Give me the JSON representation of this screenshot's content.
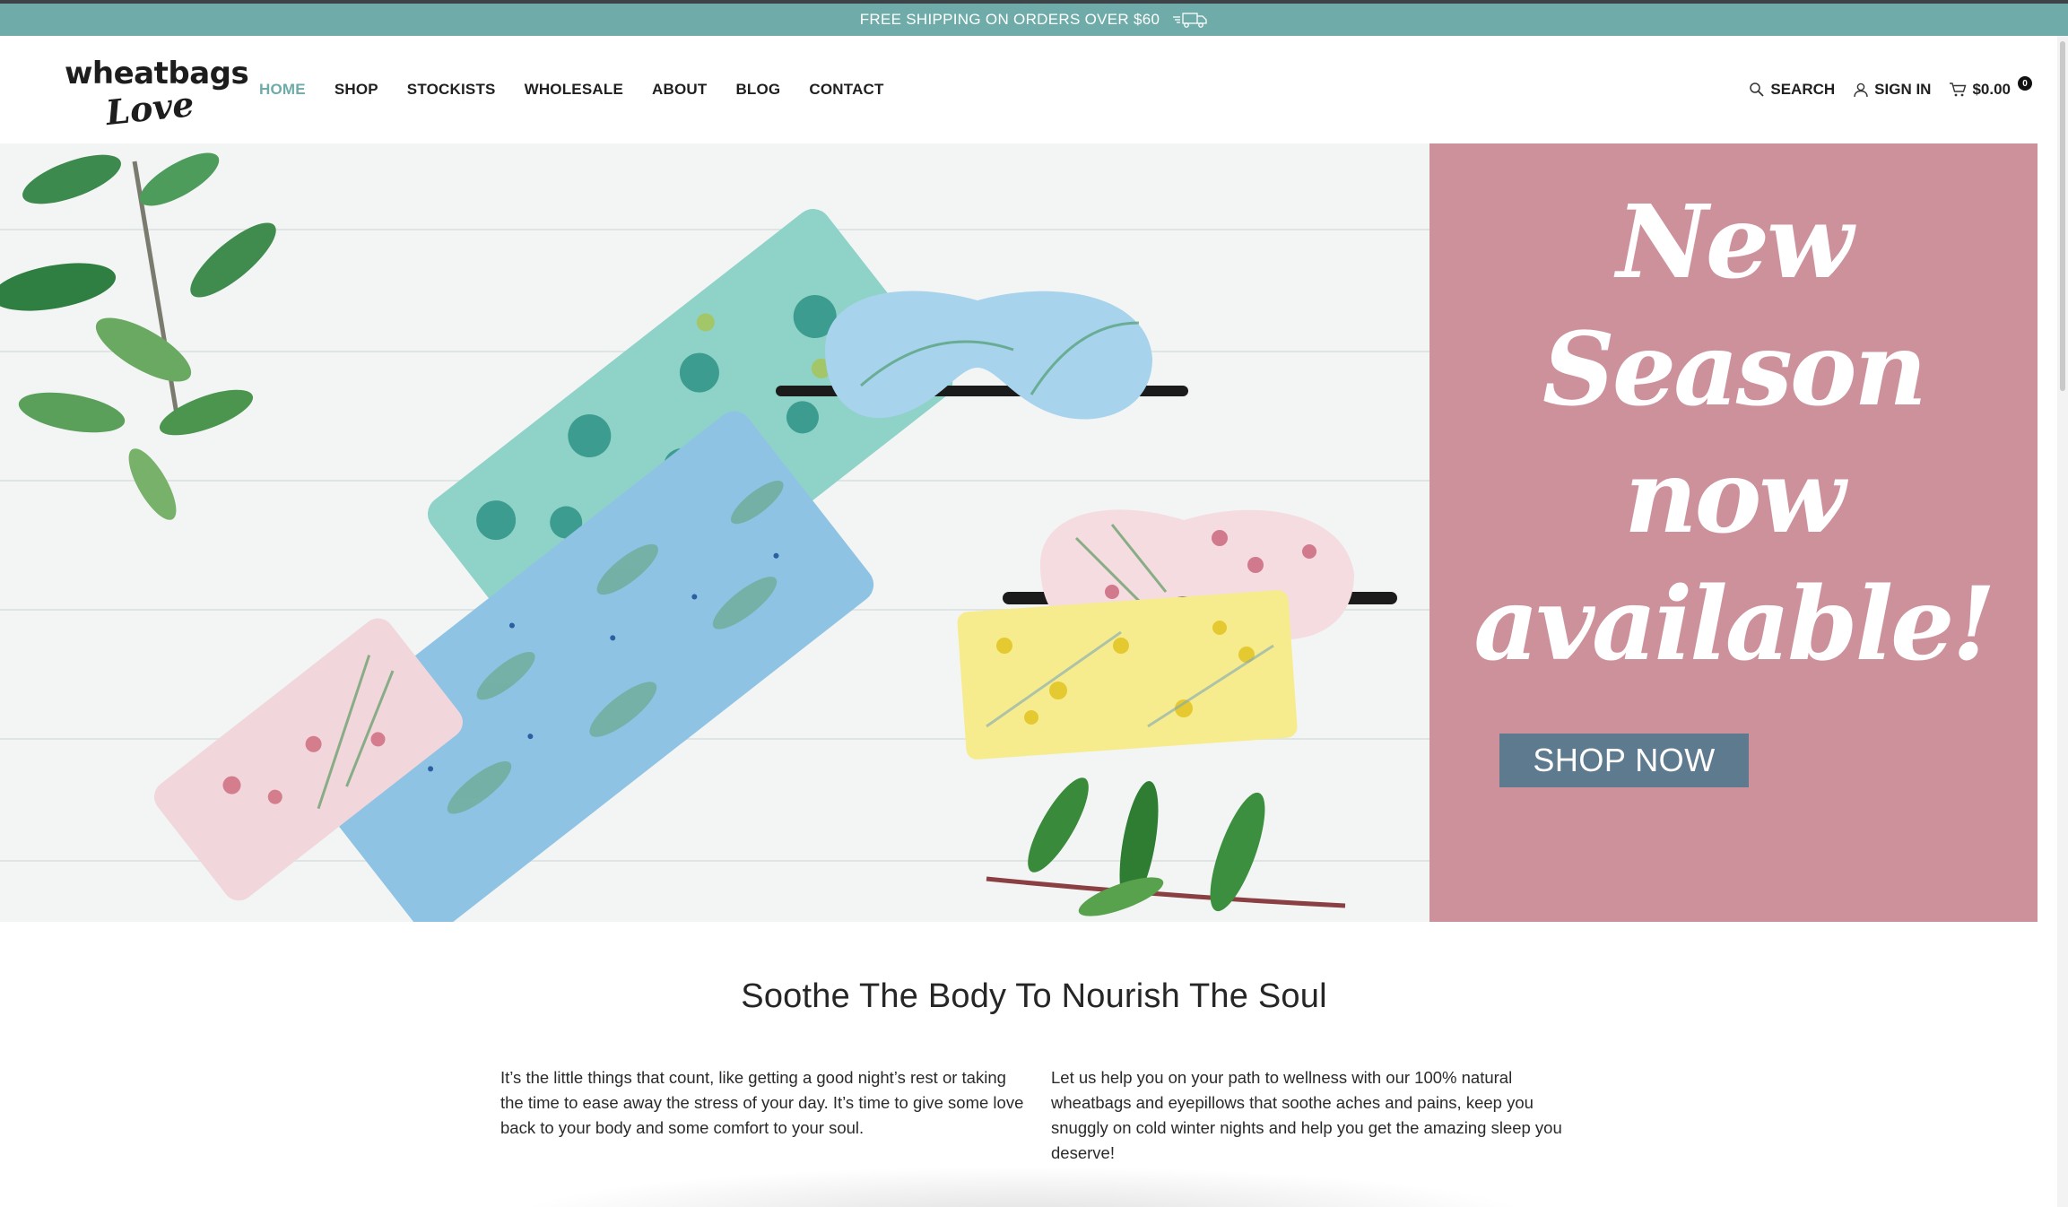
{
  "announcement": {
    "text": "FREE SHIPPING ON ORDERS OVER $60",
    "icon": "truck-icon"
  },
  "brand": {
    "line1": "wheatbags",
    "line2": "Love"
  },
  "nav": {
    "items": [
      {
        "label": "HOME",
        "active": true
      },
      {
        "label": "SHOP"
      },
      {
        "label": "STOCKISTS"
      },
      {
        "label": "WHOLESALE"
      },
      {
        "label": "ABOUT"
      },
      {
        "label": "BLOG"
      },
      {
        "label": "CONTACT"
      }
    ]
  },
  "header_utils": {
    "search_label": "SEARCH",
    "signin_label": "SIGN IN",
    "cart_total": "$0.00",
    "cart_count": "0"
  },
  "hero": {
    "headline_line1": "New Season",
    "headline_line2": "now",
    "headline_line3": "available!",
    "cta_label": "SHOP NOW"
  },
  "intro": {
    "title": "Soothe The Body To Nourish The Soul",
    "col1": "It’s the little things that count, like getting a good night’s rest or taking the time to ease away the stress of your day. It’s time to give some love back to your body and some comfort to your soul.",
    "col2": "Let us help you on your path to wellness with our 100% natural wheatbags and eyepillows that soothe aches and pains, keep you snuggly on cold winter nights and help you get the amazing sleep you deserve!"
  },
  "colors": {
    "accent": "#6eaba9",
    "promo_bg": "#cd919c",
    "cta_bg": "#5d7a8f"
  }
}
